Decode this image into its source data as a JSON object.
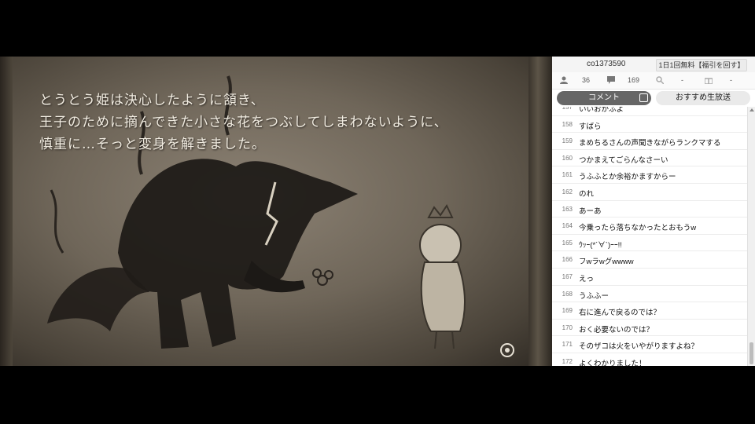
{
  "story_text": {
    "line1": "とうとう姫は決心したように頷き、",
    "line2": "王子のために摘んできた小さな花をつぶしてしまわないように、",
    "line3": "慎重に…そっと変身を解きました。"
  },
  "panel": {
    "community_id": "co1373590",
    "free_button": "1日1回無料【福引を回す】",
    "viewers": "36",
    "comments": "169",
    "ad_points": "-",
    "gift_points": "-",
    "tabs": {
      "comment": "コメント",
      "recommend": "おすすめ生放送"
    }
  },
  "comments": [
    {
      "no": "157",
      "text": "いいおかふよ"
    },
    {
      "no": "158",
      "text": "すばら"
    },
    {
      "no": "159",
      "text": "まめちるさんの声聞きながらランクマする"
    },
    {
      "no": "160",
      "text": "つかまえてごらんなさーい"
    },
    {
      "no": "161",
      "text": "うふふとか余裕かますからー"
    },
    {
      "no": "162",
      "text": "のれ"
    },
    {
      "no": "163",
      "text": "あーあ"
    },
    {
      "no": "164",
      "text": "今乗ったら落ちなかったとおもうw"
    },
    {
      "no": "165",
      "text": "ｳｯｰ(*´∀`)ｰｰ!!"
    },
    {
      "no": "166",
      "text": "フwラwグwwww"
    },
    {
      "no": "167",
      "text": "えっ"
    },
    {
      "no": "168",
      "text": "うふふー"
    },
    {
      "no": "169",
      "text": "右に進んで戻るのでは？"
    },
    {
      "no": "170",
      "text": "おく必要ないのでは？"
    },
    {
      "no": "171",
      "text": "そのザコは火をいやがりますよね？"
    },
    {
      "no": "172",
      "text": "よくわかりました！"
    }
  ]
}
